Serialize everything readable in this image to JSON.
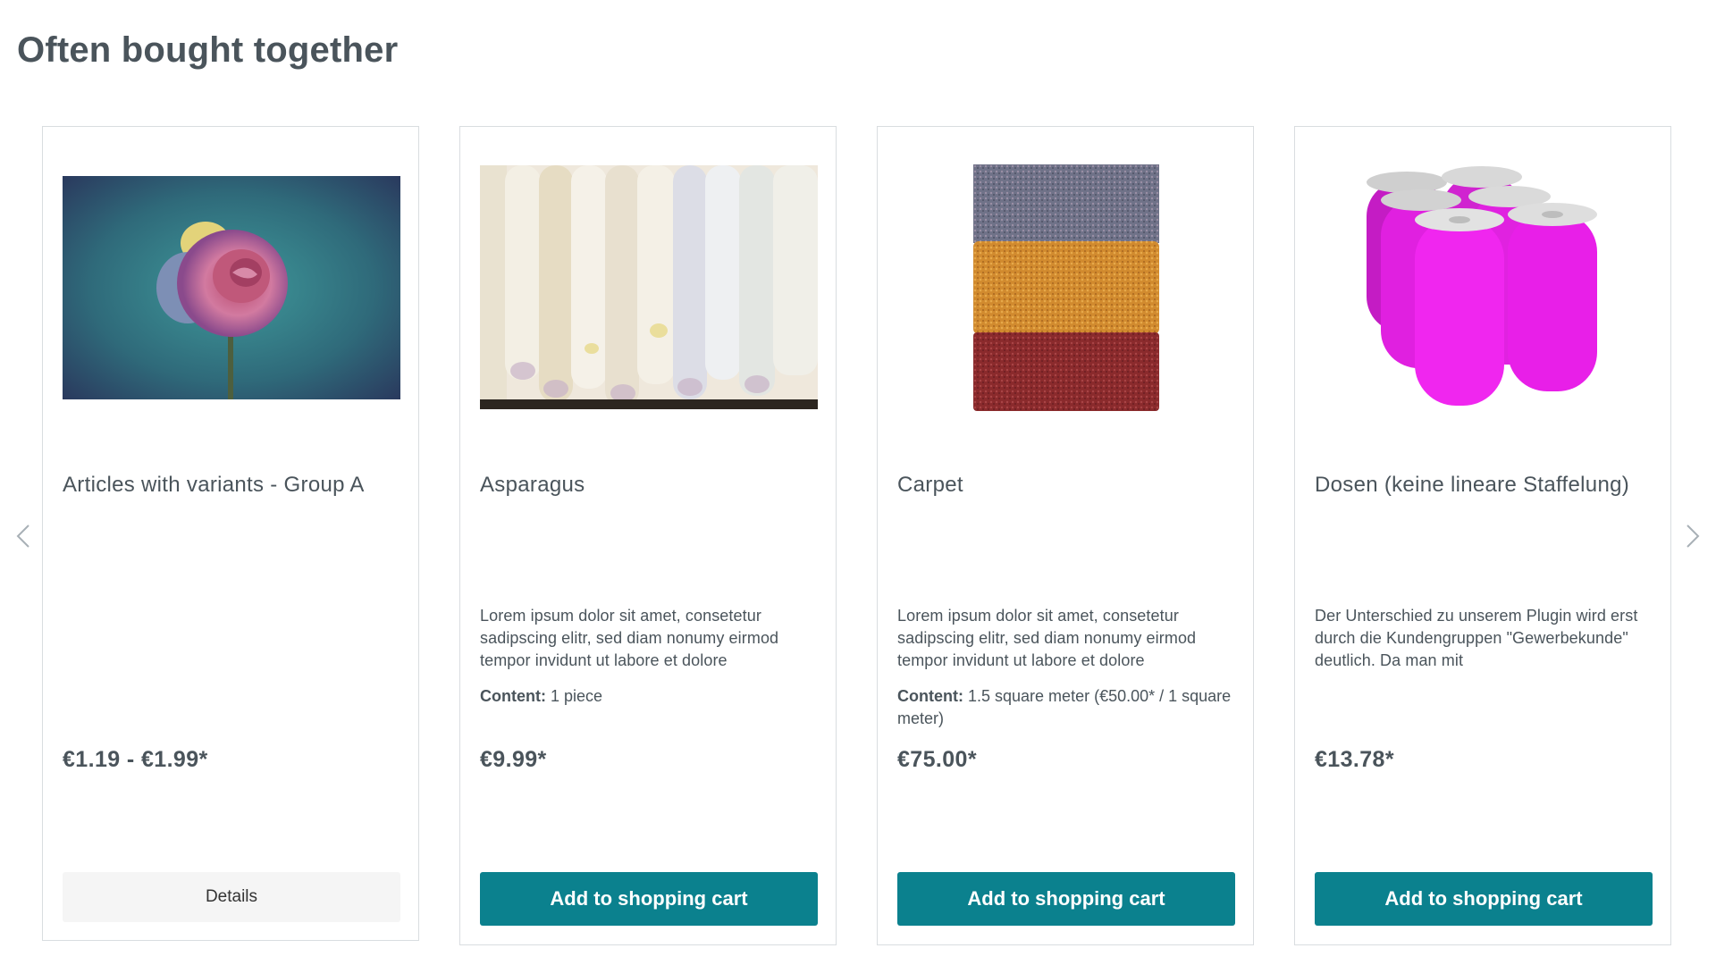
{
  "section": {
    "title": "Often bought together"
  },
  "navigation": {
    "prev_icon": "chevron-left-icon",
    "next_icon": "chevron-right-icon"
  },
  "colors": {
    "accent": "#0b818e",
    "text": "#4a545b",
    "border": "#d9dde0",
    "details_bg": "#f5f5f5"
  },
  "products": [
    {
      "name": "Articles with variants - Group A",
      "image": "rose-image",
      "description": "",
      "content_label": "",
      "content_value": "",
      "price": "€1.19 - €1.99*",
      "action": "Details"
    },
    {
      "name": "Asparagus",
      "image": "asparagus-image",
      "description": "Lorem ipsum dolor sit amet, consetetur sadipscing elitr, sed diam nonumy eirmod tempor invidunt ut labore et dolore",
      "content_label": "Content:",
      "content_value": "1 piece",
      "price": "€9.99*",
      "action": "Add to shopping cart"
    },
    {
      "name": "Carpet",
      "image": "carpet-image",
      "description": "Lorem ipsum dolor sit amet, consetetur sadipscing elitr, sed diam nonumy eirmod tempor invidunt ut labore et dolore",
      "content_label": "Content:",
      "content_value": "1.5 square meter (€50.00* / 1 square meter)",
      "price": "€75.00*",
      "action": "Add to shopping cart"
    },
    {
      "name": "Dosen (keine lineare Staffelung)",
      "image": "cans-image",
      "description": "Der Unterschied zu unserem Plugin wird erst durch die Kundengruppen \"Gewerbekunde\" deutlich. Da man mit",
      "content_label": "",
      "content_value": "",
      "price": "€13.78*",
      "action": "Add to shopping cart"
    }
  ]
}
